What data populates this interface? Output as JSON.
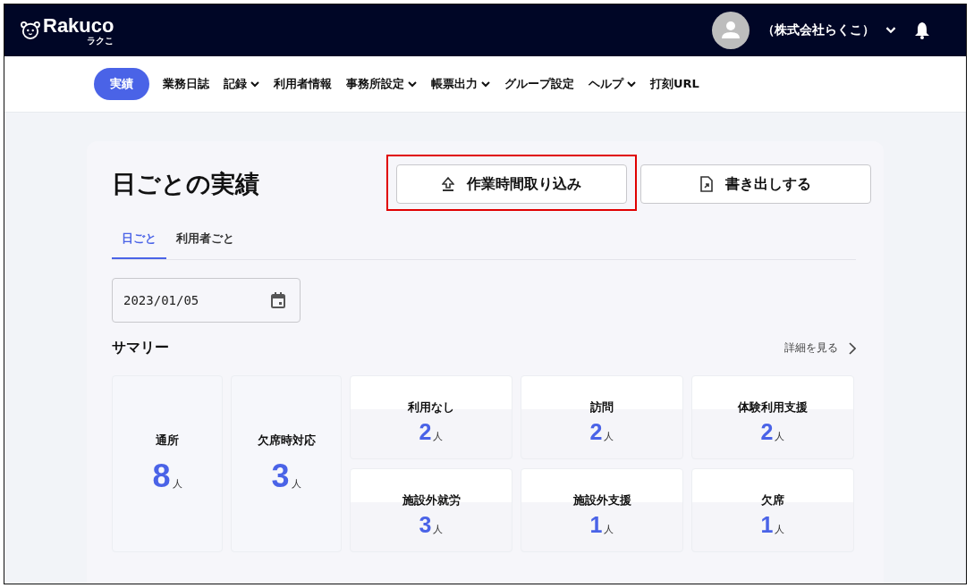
{
  "header": {
    "logo": "Rakuco",
    "logo_sub": "ラクこ",
    "account": "（株式会社らくこ）"
  },
  "nav": [
    {
      "label": "実績",
      "selected": true,
      "dropdown": false
    },
    {
      "label": "業務日誌",
      "selected": false,
      "dropdown": false
    },
    {
      "label": "記録",
      "selected": false,
      "dropdown": true
    },
    {
      "label": "利用者情報",
      "selected": false,
      "dropdown": false
    },
    {
      "label": "事務所設定",
      "selected": false,
      "dropdown": true
    },
    {
      "label": "帳票出力",
      "selected": false,
      "dropdown": true
    },
    {
      "label": "グループ設定",
      "selected": false,
      "dropdown": false
    },
    {
      "label": "ヘルプ",
      "selected": false,
      "dropdown": true
    },
    {
      "label": "打刻URL",
      "selected": false,
      "dropdown": false
    }
  ],
  "page": {
    "title": "日ごとの実績",
    "buttons": [
      {
        "kind": "import",
        "label": "作業時間取り込み",
        "highlighted": true
      },
      {
        "kind": "export",
        "label": "書き出しする",
        "highlighted": false
      }
    ],
    "tabs": [
      {
        "label": "日ごと",
        "selected": true
      },
      {
        "label": "利用者ごと",
        "selected": false
      }
    ],
    "date": "2023/01/05",
    "summary_title": "サマリー",
    "detail_link": "詳細を見る",
    "summary": [
      {
        "kind": "tall",
        "label": "通所",
        "count": "8",
        "unit": "人"
      },
      {
        "kind": "tall",
        "label": "欠席時対応",
        "count": "3",
        "unit": "人"
      },
      {
        "kind": "small",
        "label": "利用なし",
        "count": "2",
        "unit": "人"
      },
      {
        "kind": "small",
        "label": "訪問",
        "count": "2",
        "unit": "人"
      },
      {
        "kind": "small",
        "label": "体験利用支援",
        "count": "2",
        "unit": "人"
      },
      {
        "kind": "small",
        "label": "施設外就労",
        "count": "3",
        "unit": "人"
      },
      {
        "kind": "small",
        "label": "施設外支援",
        "count": "1",
        "unit": "人"
      },
      {
        "kind": "small",
        "label": "欠席",
        "count": "1",
        "unit": "人"
      }
    ]
  }
}
